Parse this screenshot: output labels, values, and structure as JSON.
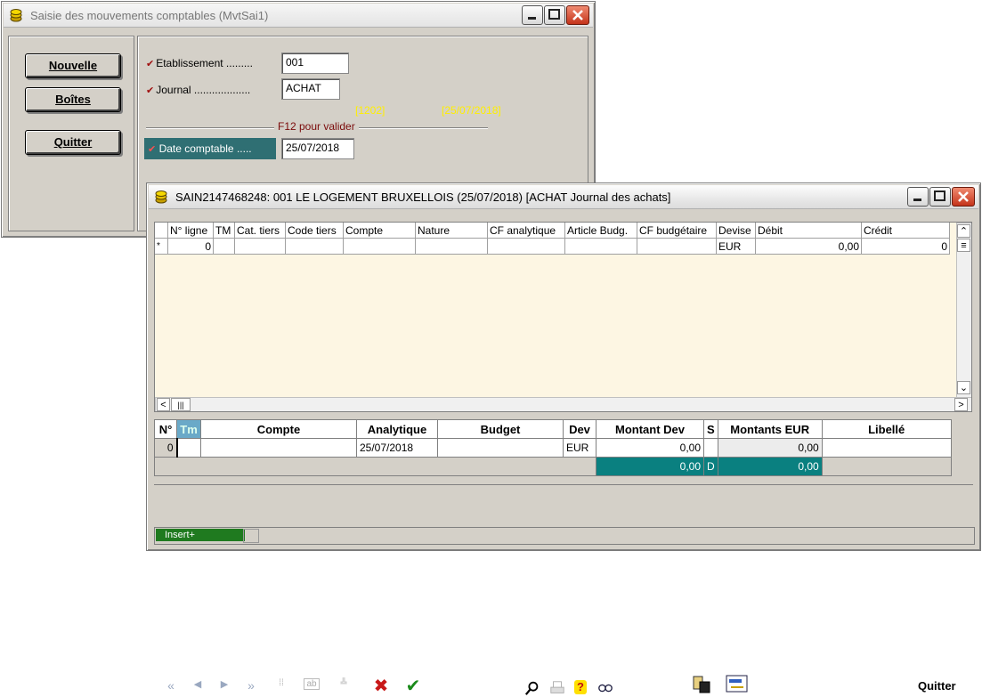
{
  "back_window": {
    "title": "Saisie des mouvements comptables (MvtSai1)",
    "buttons": {
      "nouvelle": "Nouvelle",
      "boites": "Boîtes",
      "quitter": "Quitter"
    },
    "fields": {
      "etablissement_label": "Etablissement .........",
      "etablissement_value": "001",
      "journal_label": "Journal ...................",
      "journal_value": "ACHAT",
      "date_label": "Date comptable .....",
      "date_value": "25/07/2018"
    },
    "info_code": "[1202]",
    "info_date": "[25/07/2018]",
    "validate_hint": "F12 pour valider",
    "check_glyph": "✔"
  },
  "front_window": {
    "title": "SAIN2147468248: 001 LE LOGEMENT BRUXELLOIS (25/07/2018) [ACHAT Journal des achats]",
    "grid": {
      "columns": [
        "N° ligne",
        "TM",
        "Cat. tiers",
        "Code tiers",
        "Compte",
        "Nature",
        "CF analytique",
        "Article Budg.",
        "CF budgétaire",
        "Devise",
        "Débit",
        "Crédit"
      ],
      "row": {
        "marker": "*",
        "n_ligne": "0",
        "devise": "EUR",
        "debit": "0,00",
        "credit": "0"
      }
    },
    "form": {
      "headers": [
        "N°",
        "Tm",
        "Compte",
        "Analytique",
        "Budget",
        "Dev",
        "Montant Dev",
        "S",
        "Montants EUR",
        "Libellé"
      ],
      "row": {
        "n": "0",
        "tm": "",
        "compte": "",
        "analytique": "25/07/2018",
        "budget": "",
        "dev": "EUR",
        "montant_dev": "0,00",
        "s": "",
        "montants_eur": "0,00",
        "libelle": ""
      },
      "totals": {
        "montant_dev": "0,00",
        "s": "D",
        "montants_eur": "0,00"
      }
    },
    "toolbar": {
      "first": "«",
      "prev": "◀",
      "next": "▶",
      "last": "»",
      "cancel": "✖",
      "confirm": "✔",
      "help": "?",
      "quitter": "Quitter"
    },
    "status": {
      "mode": "Insert+"
    }
  },
  "colors": {
    "teal": "#2f6f73",
    "dark_teal": "#0a8080",
    "grid_bg": "#fdf6e3",
    "yellow": "#ffef00",
    "status_green": "#1f7a1f",
    "cancel_red": "#c81818",
    "confirm_green": "#1a8a1a"
  },
  "icons": [
    "coins-icon",
    "search-icon",
    "printer-icon",
    "help-icon",
    "glasses-icon",
    "export-icon",
    "card-icon"
  ]
}
